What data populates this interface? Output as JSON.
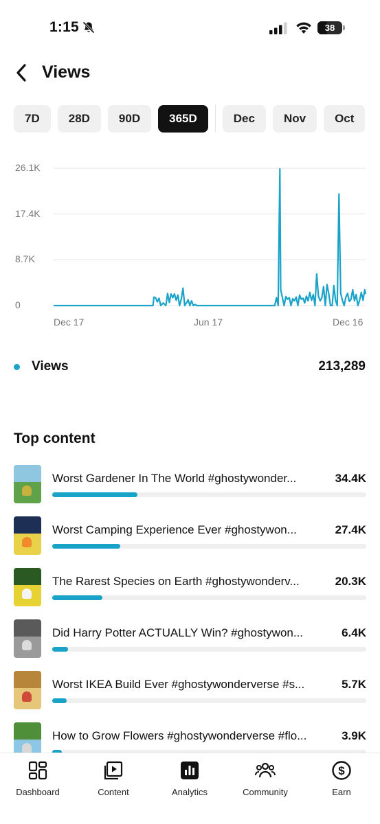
{
  "status_bar": {
    "time": "1:15",
    "battery": "38",
    "battery_level": 0.38,
    "icons": [
      "bell-slash-icon",
      "signal-icon",
      "wifi-icon",
      "battery-icon"
    ]
  },
  "header": {
    "title": "Views",
    "back_icon": "chevron-left-icon"
  },
  "periods": {
    "items": [
      "7D",
      "28D",
      "90D",
      "365D",
      "Dec",
      "Nov",
      "Oct"
    ],
    "selected": "365D"
  },
  "chart_data": {
    "type": "line",
    "title": "",
    "xlabel": "",
    "ylabel": "",
    "y_ticks": [
      "26.1K",
      "17.4K",
      "8.7K",
      "0"
    ],
    "ylim": [
      0,
      26100
    ],
    "x_ticks": [
      "Dec 17",
      "Jun 17",
      "Dec 16"
    ],
    "grid": true,
    "color": "#1aa3c9",
    "series": [
      {
        "name": "Views",
        "x": [
          "Dec 17",
          "Jan 8",
          "Feb 1",
          "Feb 25",
          "Mar 20",
          "Apr 12",
          "Apr 13",
          "Apr 15",
          "Apr 17",
          "Apr 19",
          "Apr 21",
          "Apr 24",
          "Apr 27",
          "Apr 29",
          "May 1",
          "May 3",
          "May 5",
          "May 7",
          "May 9",
          "May 11",
          "May 13",
          "May 15",
          "May 17",
          "May 19",
          "May 21",
          "May 23",
          "May 25",
          "May 27",
          "May 29",
          "May 31",
          "Jun 2",
          "Jun 5",
          "Jun 8",
          "Jun 12",
          "Jul 5",
          "Aug 1",
          "Aug 20",
          "Sep 1",
          "Sep 3",
          "Sep 5",
          "Sep 7",
          "Sep 8",
          "Sep 10",
          "Sep 12",
          "Sep 14",
          "Sep 16",
          "Sep 18",
          "Sep 20",
          "Sep 22",
          "Sep 24",
          "Sep 26",
          "Sep 28",
          "Sep 30",
          "Oct 2",
          "Oct 4",
          "Oct 6",
          "Oct 8",
          "Oct 10",
          "Oct 12",
          "Oct 14",
          "Oct 16",
          "Oct 18",
          "Oct 20",
          "Oct 22",
          "Oct 24",
          "Oct 26",
          "Oct 28",
          "Oct 30",
          "Nov 1",
          "Nov 3",
          "Nov 5",
          "Nov 7",
          "Nov 9",
          "Nov 11",
          "Nov 13",
          "Nov 15",
          "Nov 17",
          "Nov 19",
          "Nov 21",
          "Nov 23",
          "Nov 25",
          "Nov 27",
          "Nov 29",
          "Dec 1",
          "Dec 3",
          "Dec 5",
          "Dec 7",
          "Dec 9",
          "Dec 11",
          "Dec 13",
          "Dec 15",
          "Dec 16"
        ],
        "values": [
          0,
          0,
          0,
          0,
          0,
          0,
          1600,
          1500,
          700,
          1400,
          0,
          500,
          0,
          2300,
          600,
          2200,
          1500,
          2200,
          1000,
          2000,
          0,
          1200,
          3300,
          0,
          500,
          1100,
          0,
          900,
          0,
          200,
          0,
          0,
          0,
          0,
          0,
          0,
          0,
          0,
          1500,
          0,
          26000,
          3000,
          1500,
          0,
          1700,
          1200,
          1500,
          0,
          1300,
          900,
          1600,
          0,
          2000,
          1200,
          1400,
          500,
          1800,
          900,
          2500,
          1000,
          2100,
          0,
          6000,
          1800,
          900,
          1500,
          3600,
          0,
          4000,
          2300,
          0,
          0,
          3800,
          1000,
          0,
          21200,
          2300,
          1000,
          0,
          1600,
          2300,
          800,
          1200,
          3000,
          900,
          2100,
          0,
          1000,
          2500,
          1000,
          3000,
          2200
        ]
      }
    ]
  },
  "summary": {
    "label": "Views",
    "total": "213,289",
    "color": "#1aa3c9"
  },
  "top_content": {
    "title": "Top content",
    "items": [
      {
        "title": "Worst Gardener In The World #ghostywonder...",
        "views": "34.4K",
        "share": 1.0,
        "thumb_colors": [
          "#8fc6e0",
          "#5fa24a",
          "#c8b23e"
        ]
      },
      {
        "title": "Worst Camping Experience Ever #ghostywon...",
        "views": "27.4K",
        "share": 0.797,
        "thumb_colors": [
          "#1e2f55",
          "#e9d24a",
          "#f08a2a"
        ]
      },
      {
        "title": "The Rarest Species on Earth #ghostywonderv...",
        "views": "20.3K",
        "share": 0.59,
        "thumb_colors": [
          "#2a5a22",
          "#e6d232",
          "#f4f4f4"
        ]
      },
      {
        "title": "Did Harry Potter ACTUALLY Win? #ghostywon...",
        "views": "6.4K",
        "share": 0.186,
        "thumb_colors": [
          "#5a5a5a",
          "#9a9a9a",
          "#dcdcdc"
        ]
      },
      {
        "title": "Worst IKEA Build Ever #ghostywonderverse #s...",
        "views": "5.7K",
        "share": 0.166,
        "thumb_colors": [
          "#b8863a",
          "#e6c77a",
          "#d04a3a"
        ]
      },
      {
        "title": "How to Grow Flowers #ghostywonderverse #flo...",
        "views": "3.9K",
        "share": 0.113,
        "thumb_colors": [
          "#4f8f3a",
          "#8ec6e6",
          "#d8d8d8"
        ]
      }
    ]
  },
  "bottom_nav": {
    "items": [
      {
        "label": "Dashboard",
        "icon": "dashboard-grid-icon"
      },
      {
        "label": "Content",
        "icon": "content-play-icon"
      },
      {
        "label": "Analytics",
        "icon": "analytics-bars-icon"
      },
      {
        "label": "Community",
        "icon": "community-people-icon"
      },
      {
        "label": "Earn",
        "icon": "earn-dollar-icon"
      }
    ],
    "selected": "Analytics"
  }
}
